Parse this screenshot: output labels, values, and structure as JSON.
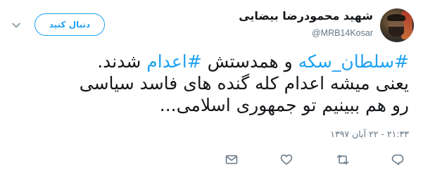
{
  "author": {
    "display_name": "شهید محمودرضا بیضایی",
    "handle": "@MRB14Kosar"
  },
  "follow_button": {
    "label": "دنبال کنید"
  },
  "tweet": {
    "line1": {
      "hashtag1": "#سلطان_سکه",
      "mid": " و همدستش ",
      "hashtag2": "#اعدام",
      "end": " شدند."
    },
    "line2": "یعنی میشه اعدام کله گنده های فاسد سیاسی",
    "line3": "رو هم ببینیم تو جمهوری اسلامی..."
  },
  "timestamp": "۲۱:۳۳ - ۲۲ آبان ۱۳۹۷",
  "actions": [
    "message-icon",
    "retweet-icon",
    "like-icon",
    "reply-icon"
  ],
  "colors": {
    "accent": "#1da1f2",
    "muted": "#657786",
    "text": "#14171a"
  }
}
